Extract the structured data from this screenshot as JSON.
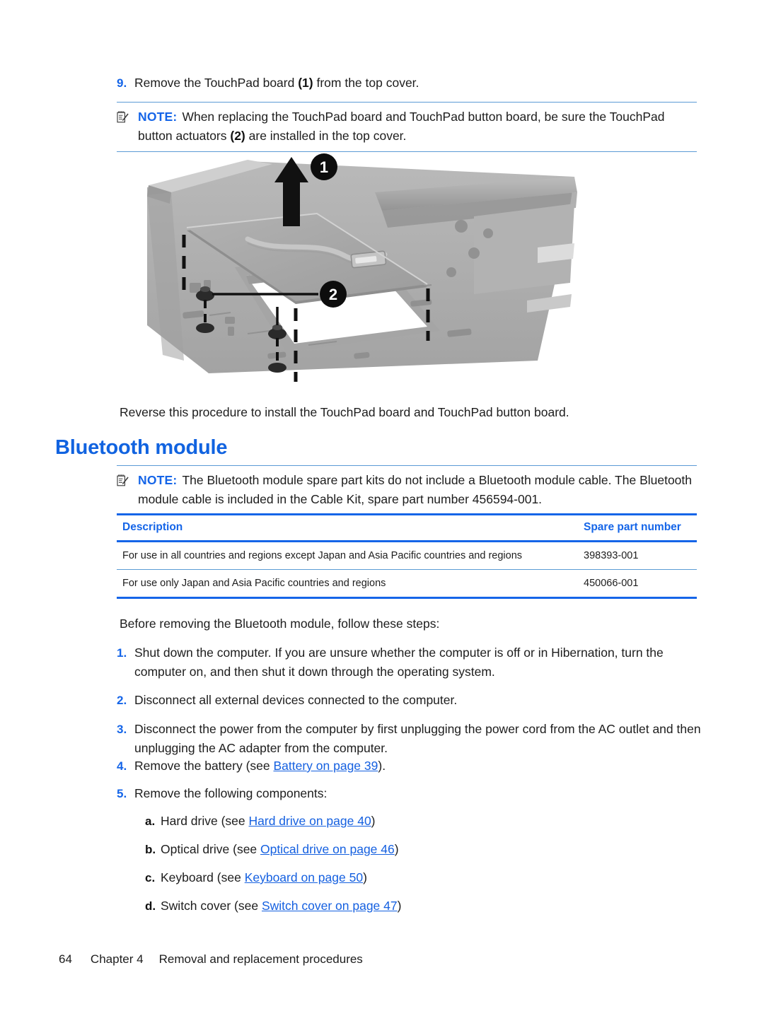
{
  "page": {
    "number": "64",
    "chapter": "Chapter 4",
    "chapter_title": "Removal and replacement procedures"
  },
  "step9": {
    "number": "9.",
    "text_before": "Remove the TouchPad board ",
    "cue": "(1)",
    "text_after": " from the top cover."
  },
  "note_touchpad": {
    "icon": "note-icon",
    "label": "NOTE:",
    "text_before": "When replacing the TouchPad board and TouchPad button board, be sure the TouchPad button actuators ",
    "cue": "(2)",
    "text_after": " are installed in the top cover."
  },
  "figure": {
    "name": "touchpad-board-removal-illustration",
    "callouts": [
      {
        "id": "1",
        "meaning": "TouchPad board lift direction"
      },
      {
        "id": "2",
        "meaning": "TouchPad button actuators"
      }
    ],
    "colors": {
      "cover_light": "#b6b6b6",
      "cover_mid": "#9d9d9d",
      "cover_dark": "#8a8a8a",
      "board": "#a8a8a8",
      "callout": "#000000"
    }
  },
  "reverse_note": "Reverse this procedure to install the TouchPad board and TouchPad button board.",
  "heading": "Bluetooth module",
  "note_bluetooth": {
    "label": "NOTE:",
    "text": "The Bluetooth module spare part kits do not include a Bluetooth module cable. The Bluetooth module cable is included in the Cable Kit, spare part number 456594-001."
  },
  "table": {
    "headers": [
      "Description",
      "Spare part number"
    ],
    "rows": [
      [
        "For use in all countries and regions except Japan and Asia Pacific countries and regions",
        "398393-001"
      ],
      [
        "For use only Japan and Asia Pacific countries and regions",
        "450066-001"
      ]
    ]
  },
  "intro": "Before removing the Bluetooth module, follow these steps:",
  "steps": [
    {
      "number": "1.",
      "text": "Shut down the computer. If you are unsure whether the computer is off or in Hibernation, turn the computer on, and then shut it down through the operating system."
    },
    {
      "number": "2.",
      "text": "Disconnect all external devices connected to the computer."
    },
    {
      "number": "3.",
      "text": "Disconnect the power from the computer by first unplugging the power cord from the AC outlet and then unplugging the AC adapter from the computer."
    }
  ],
  "step4": {
    "number": "4.",
    "text_before": "Remove the battery (see ",
    "link": "Battery on page 39",
    "text_after": ")."
  },
  "step5": {
    "number": "5.",
    "text": "Remove the following components:",
    "substeps": [
      {
        "number": "a.",
        "text_before": "Hard drive (see ",
        "link": "Hard drive on page 40",
        "text_after": ")"
      },
      {
        "number": "b.",
        "text_before": "Optical drive (see ",
        "link": "Optical drive on page 46",
        "text_after": ")"
      },
      {
        "number": "c.",
        "text_before": "Keyboard (see ",
        "link": "Keyboard on page 50",
        "text_after": ")"
      },
      {
        "number": "d.",
        "text_before": "Switch cover (see ",
        "link": "Switch cover on page 47",
        "text_after": ")"
      }
    ]
  },
  "colors": {
    "accent_blue": "#1565E8",
    "heading_blue": "#1163E0",
    "link_blue": "#1560E0",
    "rule_light_blue": "#5b9bd5"
  }
}
